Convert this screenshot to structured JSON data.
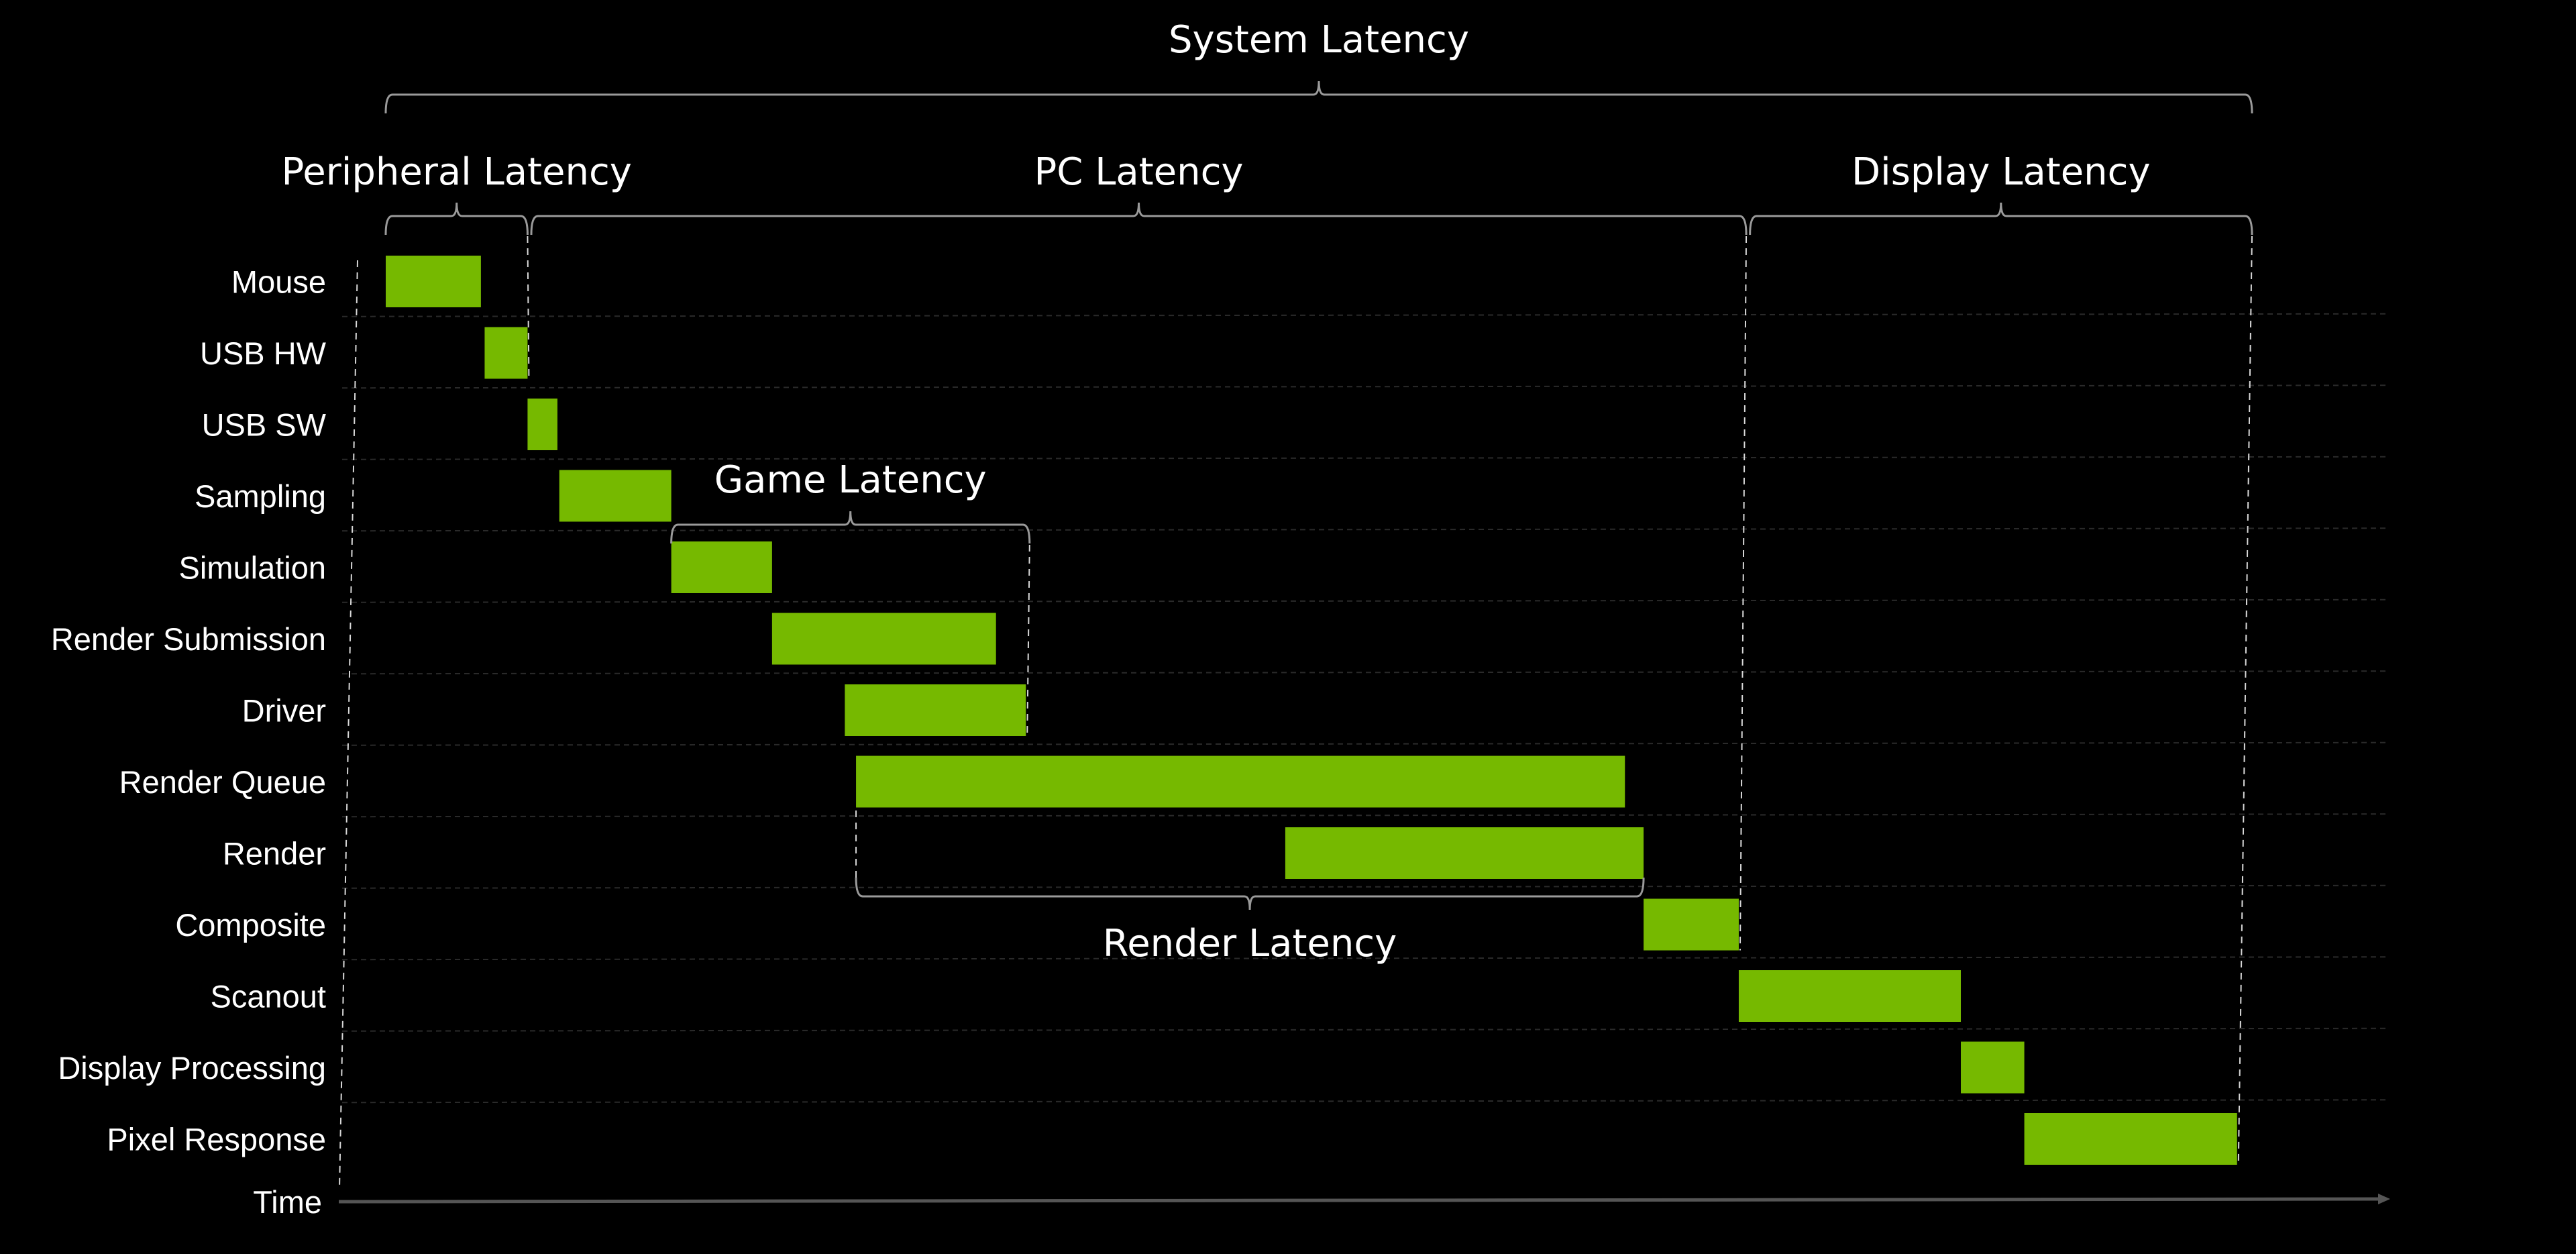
{
  "chart_data": {
    "type": "gantt",
    "title": "System Latency",
    "xlabel": "Time",
    "ylabel": "",
    "units": "relative time (System Latency span = 0–100)",
    "xlim": [
      0,
      100
    ],
    "grid": true,
    "colors": {
      "bar": "#76b900",
      "background": "#000000",
      "text": "#ffffff"
    },
    "stages": [
      {
        "name": "Mouse",
        "start": 0.0,
        "end": 5.1
      },
      {
        "name": "USB HW",
        "start": 5.3,
        "end": 7.6
      },
      {
        "name": "USB SW",
        "start": 7.6,
        "end": 9.2
      },
      {
        "name": "Sampling",
        "start": 9.3,
        "end": 15.3
      },
      {
        "name": "Simulation",
        "start": 15.3,
        "end": 20.7
      },
      {
        "name": "Render Submission",
        "start": 20.7,
        "end": 32.7
      },
      {
        "name": "Driver",
        "start": 24.6,
        "end": 34.3
      },
      {
        "name": "Render Queue",
        "start": 25.2,
        "end": 66.4
      },
      {
        "name": "Render",
        "start": 48.2,
        "end": 67.4
      },
      {
        "name": "Composite",
        "start": 67.4,
        "end": 72.5
      },
      {
        "name": "Scanout",
        "start": 72.5,
        "end": 84.4
      },
      {
        "name": "Display Processing",
        "start": 84.4,
        "end": 87.8
      },
      {
        "name": "Pixel Response",
        "start": 87.8,
        "end": 99.2
      }
    ],
    "annotations": [
      {
        "label": "System Latency",
        "start": 0.0,
        "end": 100.0,
        "placement": "top-level",
        "from_stage": "Mouse",
        "to_stage": "Pixel Response"
      },
      {
        "label": "Peripheral Latency",
        "start": 0.0,
        "end": 7.6,
        "placement": "second-level",
        "from_stage": "Mouse",
        "to_stage": "USB HW"
      },
      {
        "label": "PC Latency",
        "start": 7.8,
        "end": 72.9,
        "placement": "second-level",
        "from_stage": "USB SW",
        "to_stage": "Composite"
      },
      {
        "label": "Display Latency",
        "start": 73.1,
        "end": 100.0,
        "placement": "second-level",
        "from_stage": "Scanout",
        "to_stage": "Pixel Response"
      },
      {
        "label": "Game Latency",
        "start": 15.3,
        "end": 34.5,
        "placement": "above-bars",
        "from_stage": "Simulation",
        "to_stage": "Driver"
      },
      {
        "label": "Render Latency",
        "start": 25.2,
        "end": 67.4,
        "placement": "below-bars",
        "from_stage": "Render Queue",
        "to_stage": "Render"
      }
    ]
  }
}
